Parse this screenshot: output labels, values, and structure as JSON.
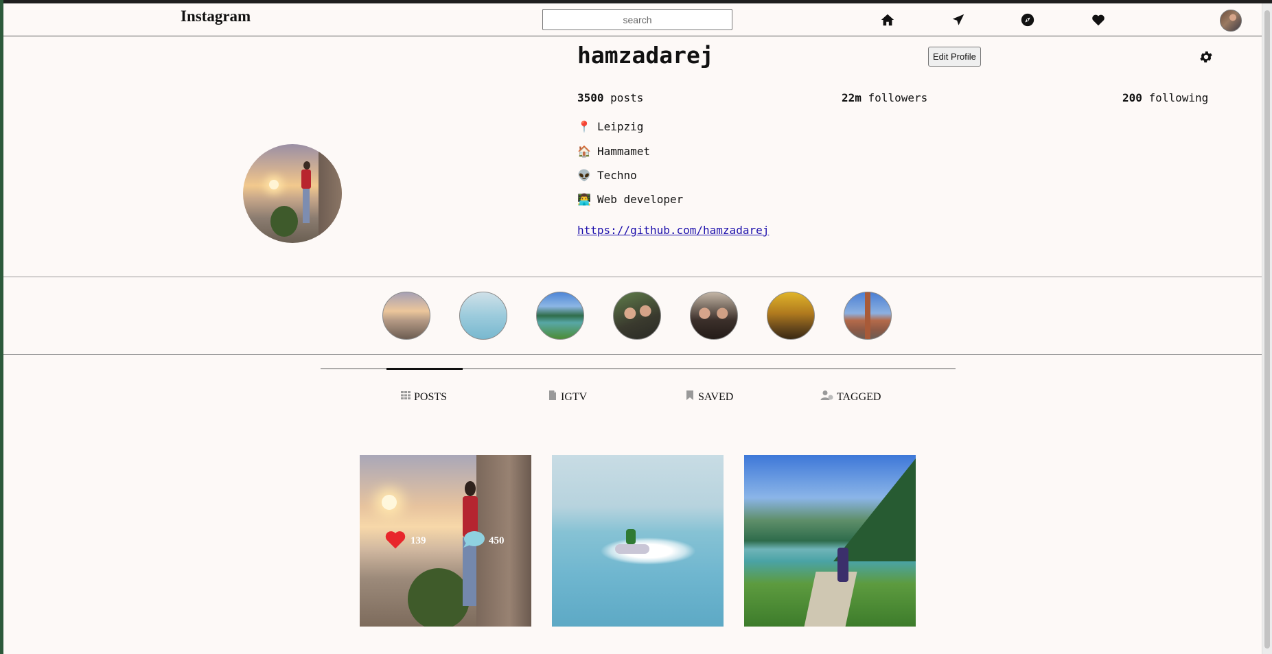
{
  "nav": {
    "logo": "Instagram",
    "search_placeholder": "search",
    "icons": [
      "home-icon",
      "direct-message-icon",
      "explore-icon",
      "activity-heart-icon"
    ]
  },
  "profile": {
    "username": "hamzadarej",
    "edit_label": "Edit Profile",
    "stats": [
      {
        "value": "3500",
        "label": "posts"
      },
      {
        "value": "22m",
        "label": "followers"
      },
      {
        "value": "200",
        "label": "following"
      }
    ],
    "bio": [
      {
        "emoji": "📍",
        "text": "Leipzig"
      },
      {
        "emoji": "🏠",
        "text": "Hammamet"
      },
      {
        "emoji": "👽",
        "text": "Techno"
      },
      {
        "emoji": "👨‍💻",
        "text": "Web developer"
      }
    ],
    "link": "https://github.com/hamzadarej"
  },
  "tabs": [
    {
      "label": "POSTS",
      "icon": "grid-icon",
      "active": true
    },
    {
      "label": "IGTV",
      "icon": "igtv-icon",
      "active": false
    },
    {
      "label": "SAVED",
      "icon": "bookmark-icon",
      "active": false
    },
    {
      "label": "TAGGED",
      "icon": "tagged-user-icon",
      "active": false
    }
  ],
  "posts": [
    {
      "likes": "139",
      "comments": "450"
    }
  ],
  "colors": {
    "background": "#fdf9f7",
    "link": "#1a0dab",
    "like": "#e8262b",
    "comment": "#8fd1e0"
  }
}
